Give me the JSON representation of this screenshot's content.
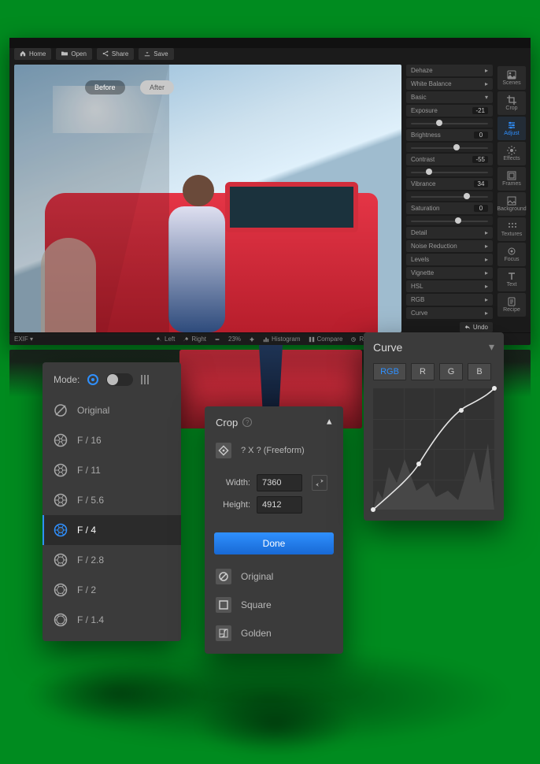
{
  "toolbar": {
    "home": "Home",
    "open": "Open",
    "share": "Share",
    "save": "Save"
  },
  "canvas": {
    "before": "Before",
    "after": "After"
  },
  "side": {
    "dehaze": "Dehaze",
    "white_balance": "White Balance",
    "basic": "Basic",
    "exposure": {
      "label": "Exposure",
      "value": "-21",
      "pos": 38
    },
    "brightness": {
      "label": "Brightness",
      "value": "0",
      "pos": 58
    },
    "contrast": {
      "label": "Contrast",
      "value": "-55",
      "pos": 26
    },
    "vibrance": {
      "label": "Vibrance",
      "value": "34",
      "pos": 70
    },
    "saturation": {
      "label": "Saturation",
      "value": "0",
      "pos": 60
    },
    "detail": "Detail",
    "noise": "Noise Reduction",
    "levels": "Levels",
    "vignette": "Vignette",
    "hsl": "HSL",
    "rgb": "RGB",
    "curve": "Curve",
    "undo": "Undo"
  },
  "vtoolbar": [
    {
      "id": "scenes",
      "label": "Scenes",
      "active": false
    },
    {
      "id": "crop",
      "label": "Crop",
      "active": false
    },
    {
      "id": "adjust",
      "label": "Adjust",
      "active": true
    },
    {
      "id": "effects",
      "label": "Effects",
      "active": false
    },
    {
      "id": "frames",
      "label": "Frames",
      "active": false
    },
    {
      "id": "background",
      "label": "Background",
      "active": false
    },
    {
      "id": "textures",
      "label": "Textures",
      "active": false
    },
    {
      "id": "focus",
      "label": "Focus",
      "active": false
    },
    {
      "id": "text",
      "label": "Text",
      "active": false
    },
    {
      "id": "recipe",
      "label": "Recipe",
      "active": false
    }
  ],
  "bottom": {
    "exif": "EXIF ▾",
    "left": "Left",
    "right": "Right",
    "zoom": "23%",
    "histogram": "Histogram",
    "compare": "Compare",
    "reset": "Reset All"
  },
  "aperture_panel": {
    "mode_label": "Mode:",
    "items": [
      {
        "label": "Original",
        "icon": "none"
      },
      {
        "label": "F / 16",
        "icon": "ap16"
      },
      {
        "label": "F / 11",
        "icon": "ap11"
      },
      {
        "label": "F / 5.6",
        "icon": "ap56"
      },
      {
        "label": "F / 4",
        "icon": "ap4",
        "selected": true
      },
      {
        "label": "F / 2.8",
        "icon": "ap28"
      },
      {
        "label": "F / 2",
        "icon": "ap2"
      },
      {
        "label": "F / 1.4",
        "icon": "ap14"
      }
    ]
  },
  "crop_panel": {
    "title": "Crop",
    "rule": "? X ? (Freeform)",
    "width_label": "Width:",
    "height_label": "Height:",
    "width": "7360",
    "height": "4912",
    "done": "Done",
    "presets": [
      {
        "label": "Original",
        "icon": "orig"
      },
      {
        "label": "Square",
        "icon": "square"
      },
      {
        "label": "Golden",
        "icon": "golden"
      }
    ]
  },
  "curve_panel": {
    "title": "Curve",
    "channels": [
      "RGB",
      "R",
      "G",
      "B"
    ],
    "channel_active": 0
  }
}
